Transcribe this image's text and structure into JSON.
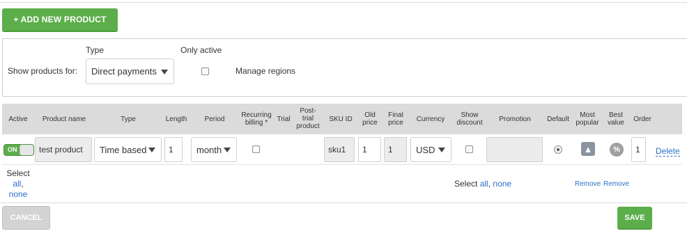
{
  "toolbar": {
    "add_label": "+ ADD NEW PRODUCT"
  },
  "filters": {
    "type_label": "Type",
    "only_active_label": "Only active",
    "show_products_label": "Show products for:",
    "type_value": "Direct payments",
    "only_active_checked": false,
    "manage_regions_label": "Manage regions"
  },
  "table": {
    "headers": {
      "active": "Active",
      "product_name": "Product name",
      "type": "Type",
      "length": "Length",
      "period": "Period",
      "recurring_1": "Recurring",
      "recurring_2": "billing *",
      "trial": "Trial",
      "post_trial_1": "Post-",
      "post_trial_2": "trial",
      "post_trial_3": "product",
      "sku_id": "SKU ID",
      "old_price_1": "Old",
      "old_price_2": "price",
      "final_price_1": "Final",
      "final_price_2": "price",
      "currency": "Currency",
      "show_discount_1": "Show",
      "show_discount_2": "discount",
      "promotion": "Promotion",
      "default": "Default",
      "most_popular_1": "Most",
      "most_popular_2": "popular",
      "best_value_1": "Best",
      "best_value_2": "value",
      "order": "Order"
    },
    "rows": [
      {
        "active_toggle": "ON",
        "product_name": "test product",
        "type": "Time based",
        "length": "1",
        "period": "month",
        "recurring_billing": false,
        "sku_id": "sku1",
        "old_price": "1",
        "final_price": "1",
        "currency": "USD",
        "show_discount": false,
        "promotion": "",
        "default": true,
        "order": "1",
        "delete_label": "Delete"
      }
    ]
  },
  "footer_row": {
    "select_label": "Select",
    "all_link": "all",
    "none_link": "none",
    "comma": ",",
    "select_mid_label": "Select",
    "remove_popular": "Remove",
    "remove_best": "Remove"
  },
  "actions": {
    "cancel_label": "CANCEL",
    "save_label": "SAVE"
  },
  "colors": {
    "accent_green": "#5cae4a",
    "link_blue": "#2a72c8",
    "header_gray": "#dbdbdb"
  }
}
